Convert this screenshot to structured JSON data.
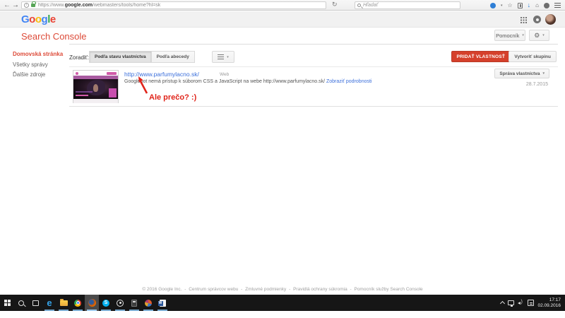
{
  "browser": {
    "url_prefix": "https://www.",
    "url_host": "google.com",
    "url_path": "/webmasters/tools/home?hl=sk",
    "search_placeholder": "Hľadať"
  },
  "header": {
    "logo_letters": [
      "G",
      "o",
      "o",
      "g",
      "l",
      "e"
    ],
    "product_title": "Search Console",
    "help_button": "Pomocník"
  },
  "sidebar": {
    "items": [
      {
        "label": "Domovská stránka",
        "active": true
      },
      {
        "label": "Všetky správy",
        "active": false
      },
      {
        "label": "Ďalšie zdroje",
        "active": false
      }
    ]
  },
  "toolbar": {
    "sort_label": "Zoradiť:",
    "sort_by_status": "Podľa stavu vlastníctva",
    "sort_by_alpha": "Podľa abecedy",
    "add_property": "PRIDAŤ VLASTNOSŤ",
    "create_group": "Vytvoriť skupinu"
  },
  "property": {
    "url": "http://www.parfumylacno.sk/",
    "type": "Web",
    "message": "Googlebot nemá prístup k súborom CSS a JavaScript na webe http://www.parfumylacno.sk/",
    "details_link": "Zobraziť podrobnosti",
    "manage_button": "Správa vlastníctva",
    "date": "28.7.2015"
  },
  "annotation": {
    "text": "Ale prečo? :)"
  },
  "footer": {
    "copyright": "© 2016 Google Inc.",
    "separator": "-",
    "links": [
      "Centrum správcov webu",
      "Zmluvné podmienky",
      "Pravidlá ochrany súkromia",
      "Pomocník služby Search Console"
    ]
  },
  "taskbar": {
    "apps": [
      "start",
      "search",
      "task-view",
      "edge",
      "file-explorer",
      "chrome",
      "firefox",
      "skype",
      "target",
      "calculator",
      "paint",
      "word"
    ],
    "active_app": "firefox",
    "time": "17:17",
    "date": "02.09.2016"
  },
  "colors": {
    "accent_red": "#dd4b39",
    "add_button_red": "#d5402b",
    "link_blue": "#3b6fdb",
    "annotation_red": "#e0241a",
    "logo": [
      "#4285f4",
      "#ea4335",
      "#fbbc05",
      "#4285f4",
      "#34a853",
      "#ea4335"
    ],
    "taskbar_bg": "#161616"
  }
}
